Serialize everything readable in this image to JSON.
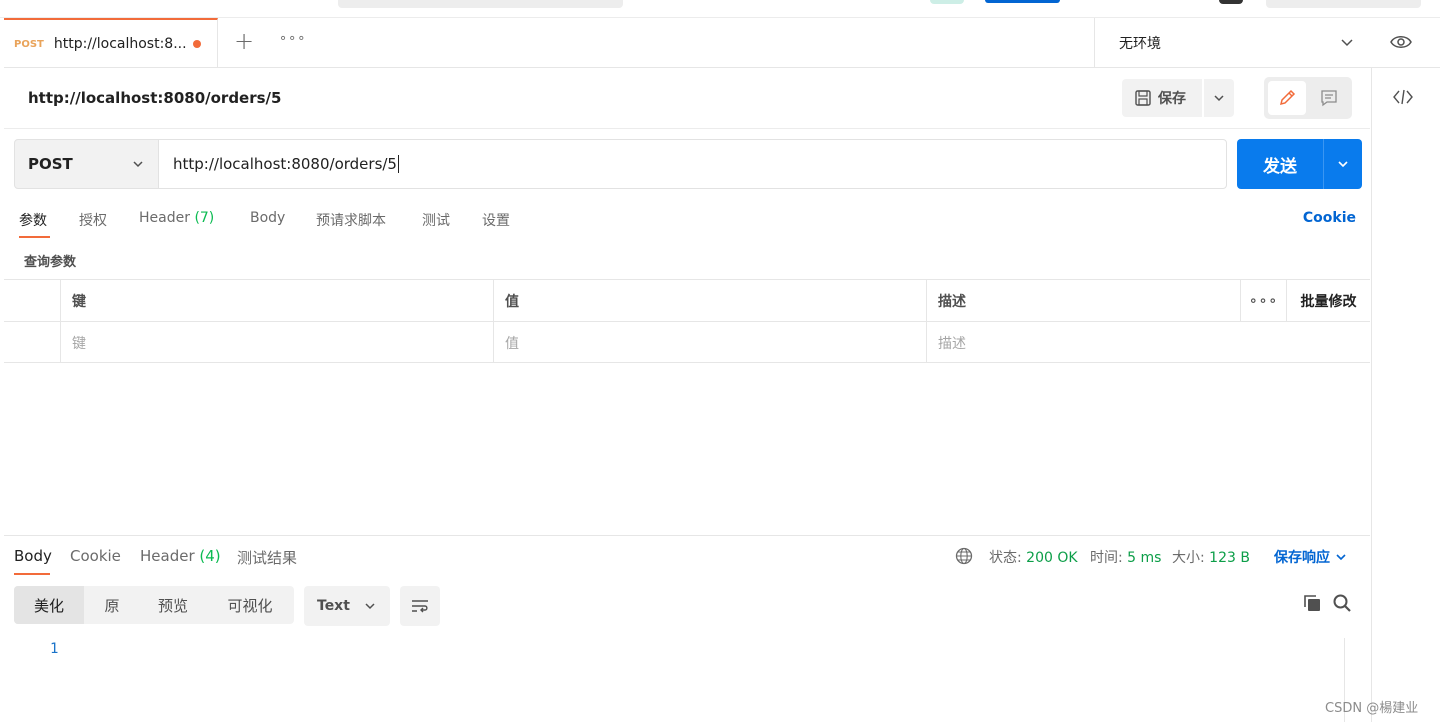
{
  "tab": {
    "method": "POST",
    "url": "http://localhost:8...",
    "more": "∘∘∘"
  },
  "environment": {
    "label": "无环境"
  },
  "request": {
    "title": "http://localhost:8080/orders/5",
    "save_label": "保存",
    "method": "POST",
    "url": "http://localhost:8080/orders/5",
    "send_label": "发送"
  },
  "request_tabs": [
    {
      "label": "参数"
    },
    {
      "label": "授权"
    },
    {
      "label": "Header",
      "count": "(7)"
    },
    {
      "label": "Body"
    },
    {
      "label": "预请求脚本"
    },
    {
      "label": "测试"
    },
    {
      "label": "设置"
    }
  ],
  "cookie_link": "Cookie",
  "query_section": "查询参数",
  "params_table": {
    "headers": {
      "key": "键",
      "value": "值",
      "description": "描述",
      "more": "∘∘∘",
      "bulk_edit": "批量修改"
    },
    "placeholders": {
      "key": "键",
      "value": "值",
      "description": "描述"
    }
  },
  "response_tabs": [
    {
      "label": "Body"
    },
    {
      "label": "Cookie"
    },
    {
      "label": "Header",
      "count": "(4)"
    },
    {
      "label": "测试结果"
    }
  ],
  "response_meta": {
    "status_label": "状态:",
    "status_value": "200 OK",
    "time_label": "时间:",
    "time_value": "5 ms",
    "size_label": "大小:",
    "size_value": "123 B",
    "save_response": "保存响应"
  },
  "format_buttons": [
    "美化",
    "原",
    "预览",
    "可视化"
  ],
  "format_type": "Text",
  "line_number": "1",
  "watermark": "CSDN @楊建业",
  "colors": {
    "accent": "#f26b3a",
    "primary": "#097bed",
    "link": "#0265d2",
    "success": "#0cbb52"
  }
}
